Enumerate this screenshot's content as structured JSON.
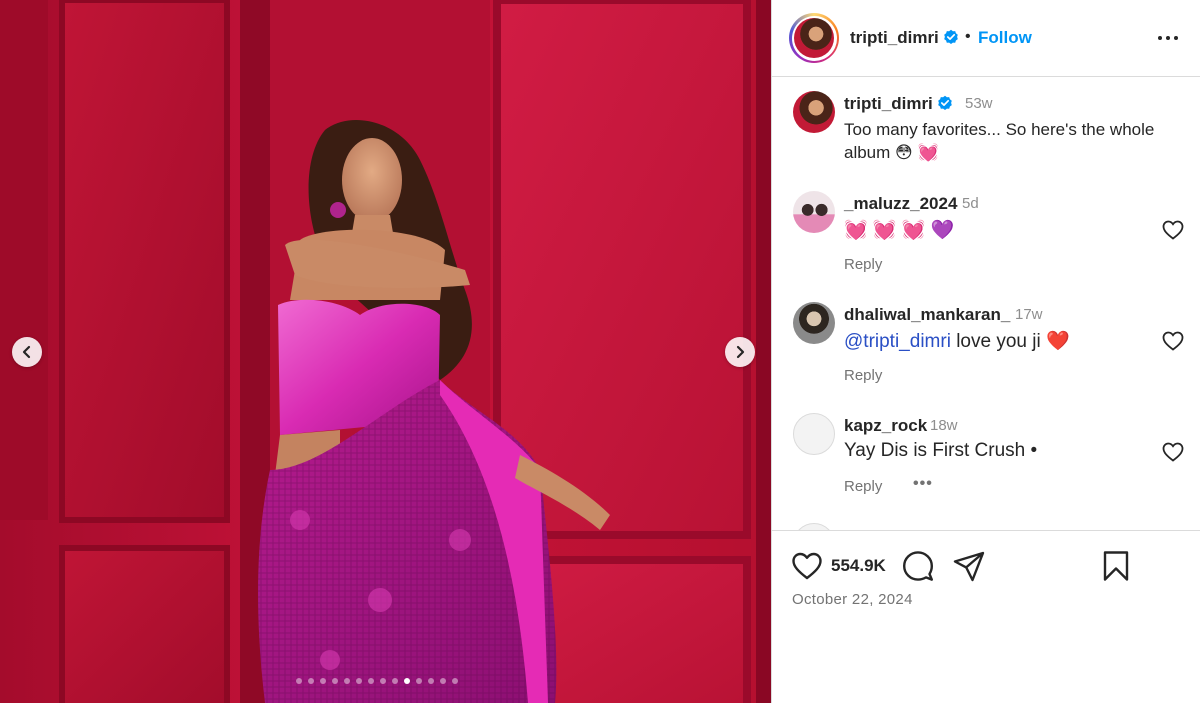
{
  "header": {
    "username": "tripti_dimri",
    "separator": "•",
    "follow_label": "Follow"
  },
  "caption": {
    "username": "tripti_dimri",
    "time": "53w",
    "text": "Too many favorites... So here's the whole album 😳 💓"
  },
  "comments": [
    {
      "username": "_maluzz_2024",
      "time": "5d",
      "text": "💓 💓 💓 💜",
      "reply_label": "Reply"
    },
    {
      "username": "dhaliwal_mankaran_",
      "time": "17w",
      "mention": "@tripti_dimri",
      "text": " love you ji ❤️",
      "reply_label": "Reply"
    },
    {
      "username": "kapz_rock",
      "time": "18w",
      "text": "Yay Dis is First Crush •",
      "reply_label": "Reply",
      "more": "•••"
    }
  ],
  "footer": {
    "likes": "554.9K",
    "date": "October 22, 2024"
  },
  "carousel": {
    "total": 14,
    "active_index": 9
  },
  "icons": [
    "chevron-left-icon",
    "chevron-right-icon",
    "verified-badge-icon",
    "more-options-icon",
    "heart-icon",
    "comment-icon",
    "share-icon",
    "bookmark-icon"
  ],
  "colors": {
    "accent": "#0095f6",
    "mention": "#2a4fc5",
    "text": "#262626",
    "muted": "#737373",
    "wall": "#b80f35",
    "saree": "#c41a8f"
  }
}
